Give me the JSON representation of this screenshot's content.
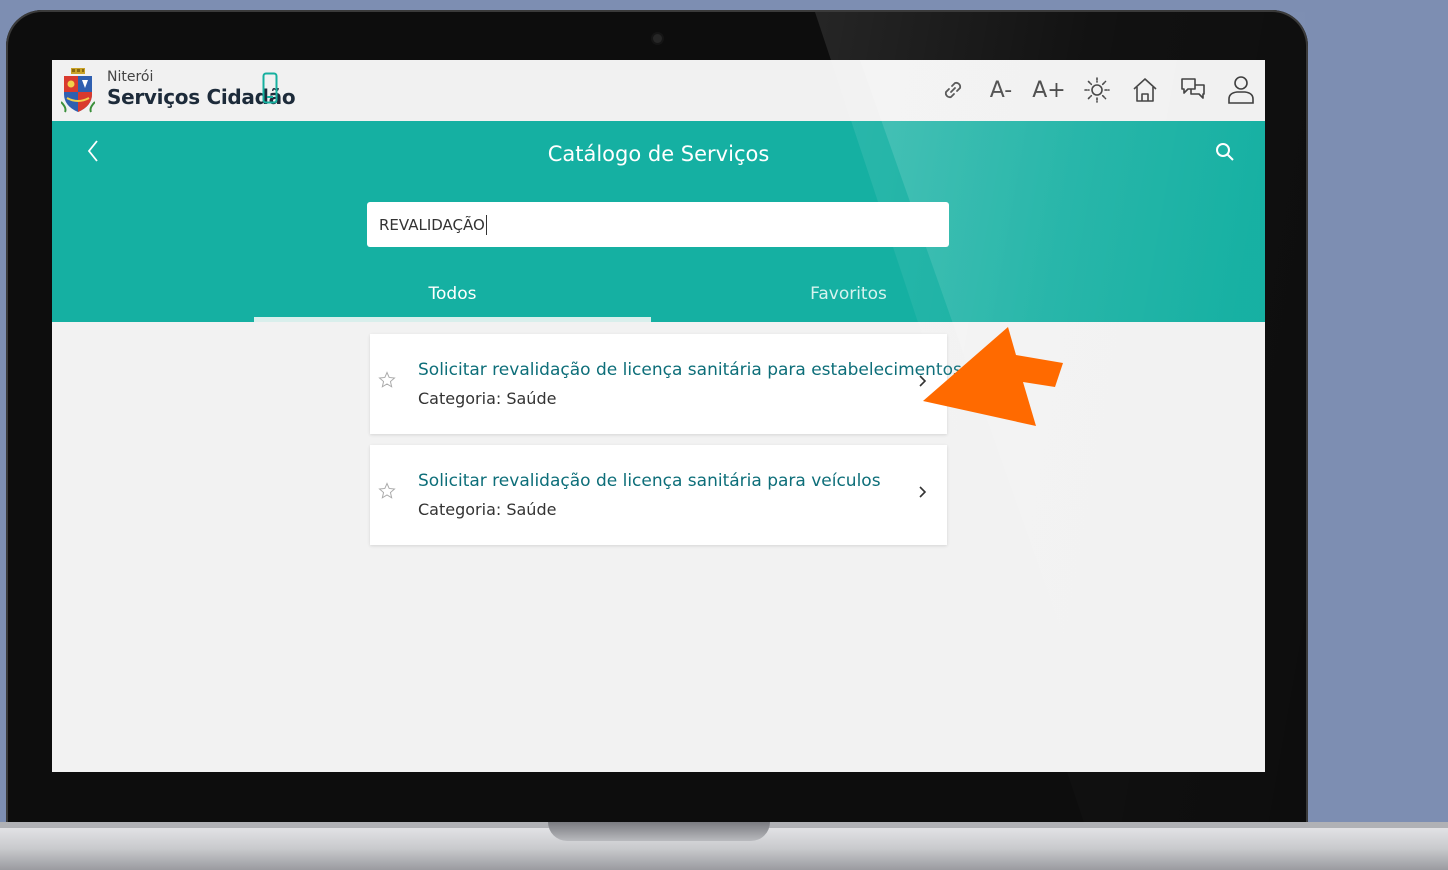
{
  "brand": {
    "city": "Niterói",
    "app_name": "Serviços Cidadão"
  },
  "toolbar": {
    "font_decrease": "A-",
    "font_increase": "A+"
  },
  "header": {
    "title": "Catálogo de Serviços"
  },
  "search": {
    "value": "REVALIDAÇÃO"
  },
  "tabs": [
    {
      "label": "Todos",
      "active": true
    },
    {
      "label": "Favoritos",
      "active": false
    }
  ],
  "results": [
    {
      "title": "Solicitar revalidação de licença sanitária para estabelecimentos",
      "category": "Categoria: Saúde"
    },
    {
      "title": "Solicitar revalidação de licença sanitária para veículos",
      "category": "Categoria: Saúde"
    }
  ],
  "colors": {
    "header_teal": "#15b0a2",
    "result_title": "#0d6e79",
    "annotation_arrow": "#ff6a00",
    "background": "#7d8eb2"
  }
}
